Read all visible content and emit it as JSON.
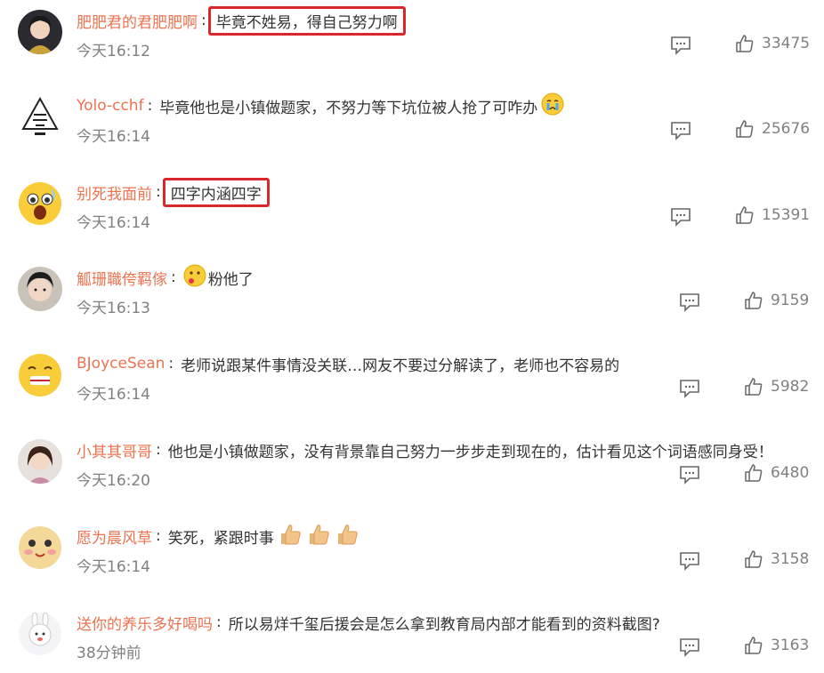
{
  "comments": [
    {
      "user": "肥肥君的君肥肥啊",
      "text": "毕竟不姓易，得自己努力啊",
      "time": "今天16:12",
      "likes": "33475",
      "boxed": true
    },
    {
      "user": "Yolo-cchf",
      "text": "毕竟他也是小镇做题家，不努力等下坑位被人抢了可咋办",
      "time": "今天16:14",
      "likes": "25676",
      "boxed": false
    },
    {
      "user": "别死我面前",
      "text": "四字内涵四字",
      "time": "今天16:14",
      "likes": "15391",
      "boxed": true
    },
    {
      "user": "觚珊職侉羁傢",
      "text": "粉他了",
      "time": "今天16:13",
      "likes": "9159",
      "boxed": false
    },
    {
      "user": "BJoyceSean",
      "text": "老师说跟某件事情没关联…网友不要过分解读了，老师也不容易的",
      "time": "今天16:14",
      "likes": "5982",
      "boxed": false
    },
    {
      "user": "小其其哥哥",
      "text": "他也是小镇做题家，没有背景靠自己努力一步步走到现在的，估计看见这个词语感同身受！",
      "time": "今天16:20",
      "likes": "6480",
      "boxed": false
    },
    {
      "user": "愿为晨风草",
      "text": "笑死，紧跟时事",
      "time": "今天16:14",
      "likes": "3158",
      "boxed": false
    },
    {
      "user": "送你的养乐多好喝吗",
      "text": "所以易烊千玺后援会是怎么拿到教育局内部才能看到的资料截图?",
      "time": "38分钟前",
      "likes": "3163",
      "boxed": false
    }
  ],
  "icons": {
    "reply": "comment-bubble-icon",
    "like": "thumbs-up-icon"
  },
  "colors": {
    "username": "#eb7350",
    "highlight_box": "#d9282c",
    "meta": "#808080"
  }
}
